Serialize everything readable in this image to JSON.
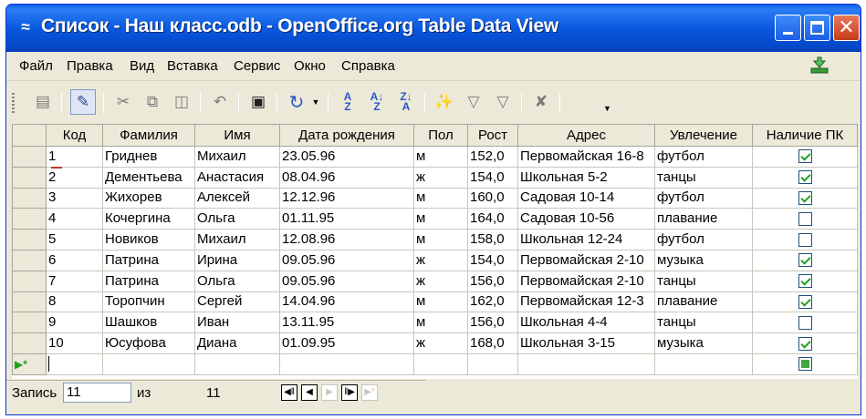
{
  "window": {
    "title": "Список - Наш класс.odb - OpenOffice.org Table Data View"
  },
  "menu": {
    "items": [
      "Файл",
      "Правка",
      "Вид",
      "Вставка",
      "Сервис",
      "Окно",
      "Справка"
    ]
  },
  "toolbar": {
    "icons": [
      "save-icon",
      "edit-data-icon",
      "cut-icon",
      "copy-icon",
      "paste-icon",
      "undo-icon",
      "find-record-icon",
      "refresh-icon",
      "sort-ascending-icon",
      "sort-az-icon",
      "sort-za-icon",
      "autofilter-icon",
      "standard-filter-icon",
      "filter-icon",
      "remove-filter-icon"
    ]
  },
  "table": {
    "columns": [
      "Код",
      "Фамилия",
      "Имя",
      "Дата рождения",
      "Пол",
      "Рост",
      "Адрес",
      "Увлечение",
      "Наличие ПК"
    ],
    "rows": [
      {
        "kod": "1",
        "familiya": "Гриднев",
        "imya": "Михаил",
        "data": "23.05.96",
        "pol": "м",
        "rost": "152,0",
        "adres": "Первомайская 16-8",
        "uvlechenie": "футбол",
        "pc": true
      },
      {
        "kod": "2",
        "familiya": "Дементьева",
        "imya": "Анастасия",
        "data": "08.04.96",
        "pol": "ж",
        "rost": "154,0",
        "adres": "Школьная 5-2",
        "uvlechenie": "танцы",
        "pc": true
      },
      {
        "kod": "3",
        "familiya": "Жихорев",
        "imya": "Алексей",
        "data": "12.12.96",
        "pol": "м",
        "rost": "160,0",
        "adres": "Садовая 10-14",
        "uvlechenie": "футбол",
        "pc": true
      },
      {
        "kod": "4",
        "familiya": "Кочергина",
        "imya": "Ольга",
        "data": "01.11.95",
        "pol": "м",
        "rost": "164,0",
        "adres": "Садовая 10-56",
        "uvlechenie": "плавание",
        "pc": false
      },
      {
        "kod": "5",
        "familiya": "Новиков",
        "imya": "Михаил",
        "data": "12.08.96",
        "pol": "м",
        "rost": "158,0",
        "adres": "Школьная 12-24",
        "uvlechenie": "футбол",
        "pc": false
      },
      {
        "kod": "6",
        "familiya": "Патрина",
        "imya": "Ирина",
        "data": "09.05.96",
        "pol": "ж",
        "rost": "154,0",
        "adres": "Первомайская 2-10",
        "uvlechenie": "музыка",
        "pc": true
      },
      {
        "kod": "7",
        "familiya": "Патрина",
        "imya": "Ольга",
        "data": "09.05.96",
        "pol": "ж",
        "rost": "156,0",
        "adres": "Первомайская 2-10",
        "uvlechenie": "танцы",
        "pc": true
      },
      {
        "kod": "8",
        "familiya": "Торопчин",
        "imya": "Сергей",
        "data": "14.04.96",
        "pol": "м",
        "rost": "162,0",
        "adres": "Первомайская 12-3",
        "uvlechenie": "плавание",
        "pc": true
      },
      {
        "kod": "9",
        "familiya": "Шашков",
        "imya": "Иван",
        "data": "13.11.95",
        "pol": "м",
        "rost": "156,0",
        "adres": "Школьная 4-4",
        "uvlechenie": "танцы",
        "pc": false
      },
      {
        "kod": "10",
        "familiya": "Юсуфова",
        "imya": "Диана",
        "data": "01.09.95",
        "pol": "ж",
        "rost": "168,0",
        "adres": "Школьная 3-15",
        "uvlechenie": "музыка",
        "pc": true
      }
    ]
  },
  "navigator": {
    "record_label": "Запись",
    "current": "11",
    "of_label": "из",
    "total": "11"
  }
}
